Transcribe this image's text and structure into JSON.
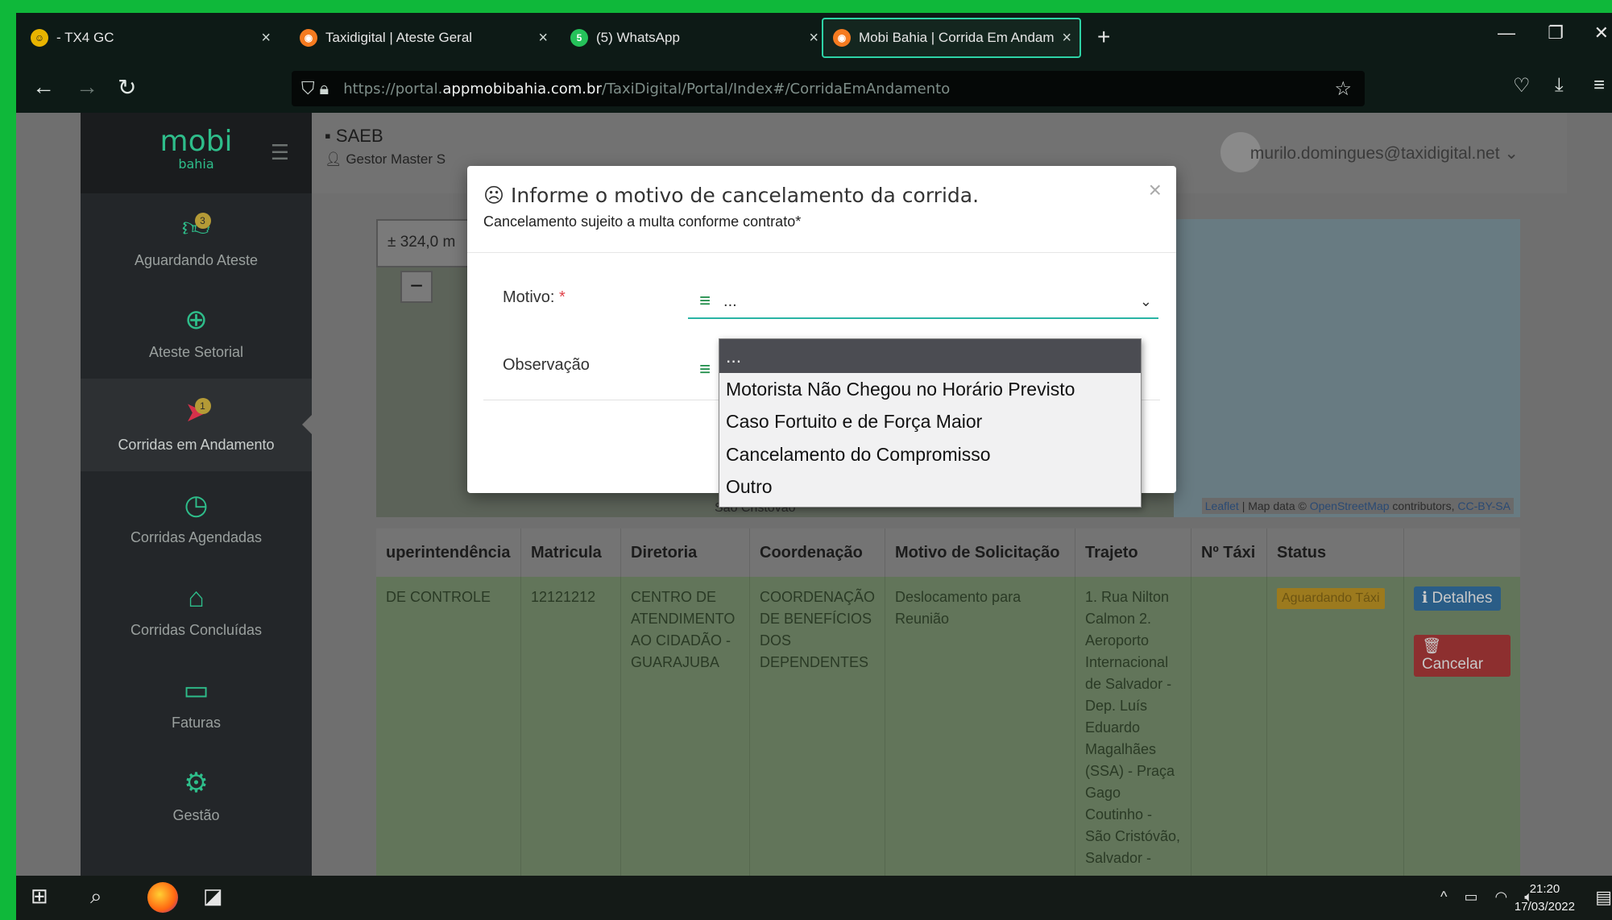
{
  "browser": {
    "tabs": [
      {
        "title": "- TX4 GC",
        "active": false,
        "icon": "tx4-icon"
      },
      {
        "title": "Taxidigital | Ateste Geral",
        "active": false,
        "icon": "taxidigital-icon"
      },
      {
        "title": "(5) WhatsApp",
        "active": false,
        "icon": "whatsapp-icon"
      },
      {
        "title": "Mobi Bahia | Corrida Em Andam",
        "active": true,
        "icon": "mobibahia-icon"
      }
    ],
    "url_prefix": "https://portal.",
    "url_domain": "appmobibahia.com.br",
    "url_path": "/TaxiDigital/Portal/Index#/CorridaEmAndamento"
  },
  "sidebar": {
    "logo_main": "mobi",
    "logo_sub": "bahia",
    "items": [
      {
        "label": "Aguardando Ateste",
        "icon": "thumbs-up-icon",
        "badge": "3"
      },
      {
        "label": "Ateste Setorial",
        "icon": "globe-icon",
        "badge": ""
      },
      {
        "label": "Corridas em Andamento",
        "icon": "paper-plane-icon",
        "badge": "1"
      },
      {
        "label": "Corridas Agendadas",
        "icon": "clock-icon",
        "badge": ""
      },
      {
        "label": "Corridas Concluídas",
        "icon": "tag-icon",
        "badge": ""
      },
      {
        "label": "Faturas",
        "icon": "credit-card-icon",
        "badge": ""
      },
      {
        "label": "Gestão",
        "icon": "gear-icon",
        "badge": ""
      }
    ]
  },
  "header": {
    "org": "SAEB",
    "role": "Gestor Master S",
    "user_email": "murilo.domingues@taxidigital.net"
  },
  "map": {
    "scale": "± 324,0 m",
    "zoom_out": "−",
    "attribution_leaflet": "Leaflet",
    "attribution_text": " | Map data © ",
    "attribution_osm": "OpenStreetMap",
    "attribution_contrib": " contributors, ",
    "attribution_license": "CC-BY-SA",
    "place_label": "São Cristóvão"
  },
  "table": {
    "headers": [
      "uperintendência",
      "Matricula",
      "Diretoria",
      "Coordenação",
      "Motivo de Solicitação",
      "Trajeto",
      "Nº Táxi",
      "Status",
      ""
    ],
    "row": {
      "superintendencia": "DE CONTROLE",
      "matricula": "12121212",
      "diretoria": "CENTRO DE ATENDIMENTO AO CIDADÃO - GUARAJUBA",
      "coordenacao": "COORDENAÇÃO DE BENEFÍCIOS DOS DEPENDENTES",
      "motivo": "Deslocamento para Reunião",
      "trajeto": "1. Rua Nilton Calmon 2. Aeroporto Internacional de Salvador - Dep. Luís Eduardo Magalhães (SSA) - Praça Gago Coutinho - São Cristóvão, Salvador -",
      "taxi": "",
      "status": "Aguardando Táxi",
      "btn_detalhes": "Detalhes",
      "btn_cancelar": "Cancelar"
    }
  },
  "modal": {
    "title": "Informe o motivo de cancelamento da corrida.",
    "subtitle": "Cancelamento sujeito a multa conforme contrato*",
    "motivo_label": "Motivo:",
    "required_mark": "*",
    "motivo_value": "...",
    "observacao_label": "Observação",
    "close": "×"
  },
  "dropdown": {
    "options": [
      "...",
      "Motorista Não Chegou no Horário Previsto",
      "Caso Fortuito e de Força Maior",
      "Cancelamento do Compromisso",
      "Outro"
    ],
    "selected_index": 0
  },
  "taskbar": {
    "time": "21:20",
    "date": "17/03/2022"
  },
  "colors": {
    "frame_green": "#0fb83a",
    "accent_teal": "#2ab4a4",
    "brand_green": "#2ebd8a",
    "active_red": "#d6314a"
  }
}
